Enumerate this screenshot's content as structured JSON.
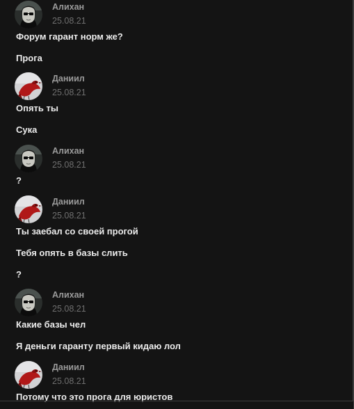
{
  "colors": {
    "background": "#141414",
    "author": "#9a9a9a",
    "timestamp": "#6f6f6f",
    "message": "#ececec",
    "daniil_avatar_bird": "#b01818"
  },
  "groups": [
    {
      "author": "Алихан",
      "time": "25.08.21",
      "avatar_icon": "person-avatar-icon",
      "messages": [
        "Форум гарант норм же?",
        "Прога"
      ]
    },
    {
      "author": "Даниил",
      "time": "25.08.21",
      "avatar_icon": "red-bird-avatar-icon",
      "messages": [
        "Опять ты",
        "Сука"
      ]
    },
    {
      "author": "Алихан",
      "time": "25.08.21",
      "avatar_icon": "person-avatar-icon",
      "messages": [
        "?"
      ]
    },
    {
      "author": "Даниил",
      "time": "25.08.21",
      "avatar_icon": "red-bird-avatar-icon",
      "messages": [
        "Ты заебал со своей прогой",
        "Тебя опять в базы слить",
        "?"
      ]
    },
    {
      "author": "Алихан",
      "time": "25.08.21",
      "avatar_icon": "person-avatar-icon",
      "messages": [
        "Какие базы чел",
        "Я деньги гаранту первый кидаю лол"
      ]
    },
    {
      "author": "Даниил",
      "time": "25.08.21",
      "avatar_icon": "red-bird-avatar-icon",
      "messages": [
        "Потому что это прога для юристов"
      ]
    }
  ]
}
